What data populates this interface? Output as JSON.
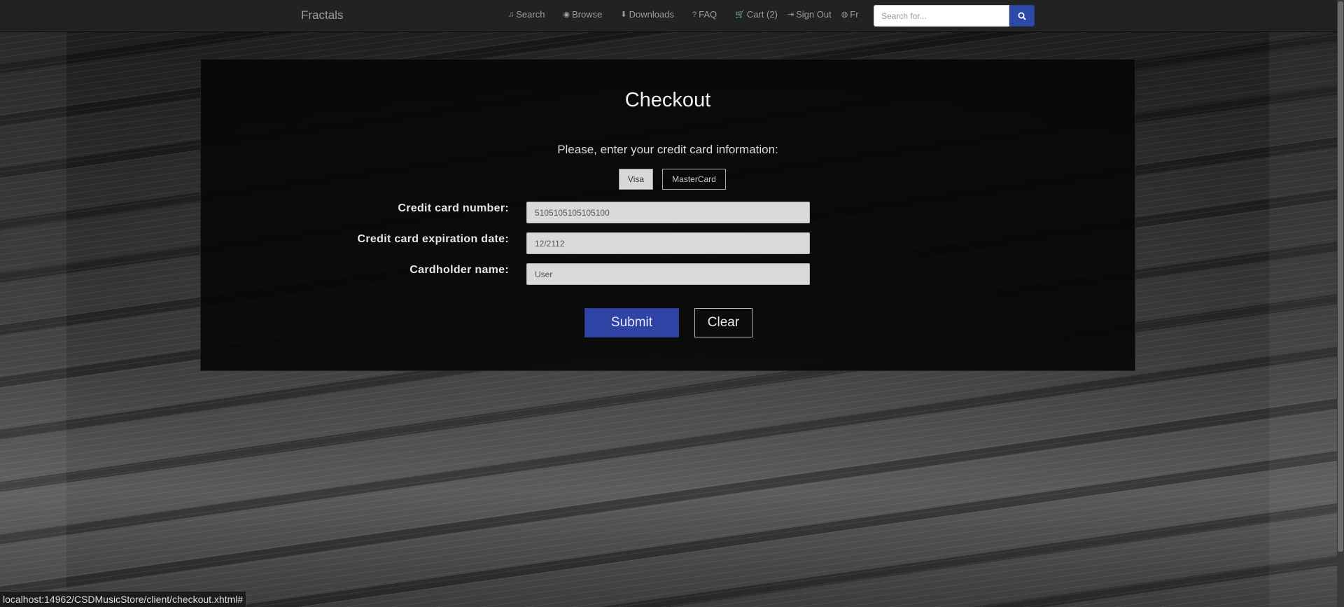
{
  "navbar": {
    "brand": "Fractals",
    "links": [
      {
        "name": "search",
        "icon": "music-note-icon",
        "glyph": "♫",
        "label": "Search"
      },
      {
        "name": "browse",
        "icon": "eye-icon",
        "glyph": "◉",
        "label": "Browse"
      },
      {
        "name": "downloads",
        "icon": "download-icon",
        "glyph": "⬇",
        "label": "Downloads"
      },
      {
        "name": "faq",
        "icon": "question-icon",
        "glyph": "?",
        "label": "FAQ"
      },
      {
        "name": "cart",
        "icon": "cart-icon",
        "glyph": "🛒",
        "label": "Cart (2)"
      },
      {
        "name": "sign-out",
        "icon": "sign-out-icon",
        "glyph": "⇥",
        "label": "Sign Out"
      },
      {
        "name": "language",
        "icon": "globe-icon",
        "glyph": "◍",
        "label": "Fr"
      }
    ],
    "search_placeholder": "Search for...",
    "search_button_icon": "search-icon"
  },
  "checkout": {
    "title": "Checkout",
    "subtitle": "Please, enter your credit card information:",
    "card_types": {
      "visa": "Visa",
      "mastercard": "MasterCard",
      "selected": "Visa"
    },
    "fields": {
      "card_number_label": "Credit card number:",
      "card_number_value": "5105105105105100",
      "expiry_label": "Credit card expiration date:",
      "expiry_value": "12/2112",
      "holder_label": "Cardholder name:",
      "holder_value": "User"
    },
    "submit_label": "Submit",
    "clear_label": "Clear"
  },
  "status_bar": {
    "url": "localhost:14962/CSDMusicStore/client/checkout.xhtml#"
  },
  "colors": {
    "accent": "#2e43a3",
    "navbar_bg": "#222222",
    "panel_bg": "#080808"
  }
}
